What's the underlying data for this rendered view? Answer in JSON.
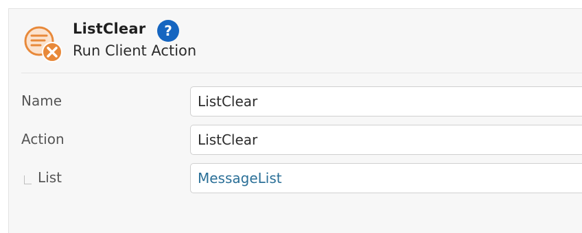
{
  "header": {
    "title": "ListClear",
    "subtitle": "Run Client Action",
    "help_glyph": "?",
    "icon": "list-clear-icon",
    "accent_color": "#e8893a",
    "help_color": "#1565c0"
  },
  "properties": [
    {
      "label": "Name",
      "value": "ListClear",
      "type": "text"
    },
    {
      "label": "Action",
      "value": "ListClear",
      "type": "dropdown"
    },
    {
      "label": "List",
      "value": "MessageList",
      "type": "dropdown"
    }
  ]
}
